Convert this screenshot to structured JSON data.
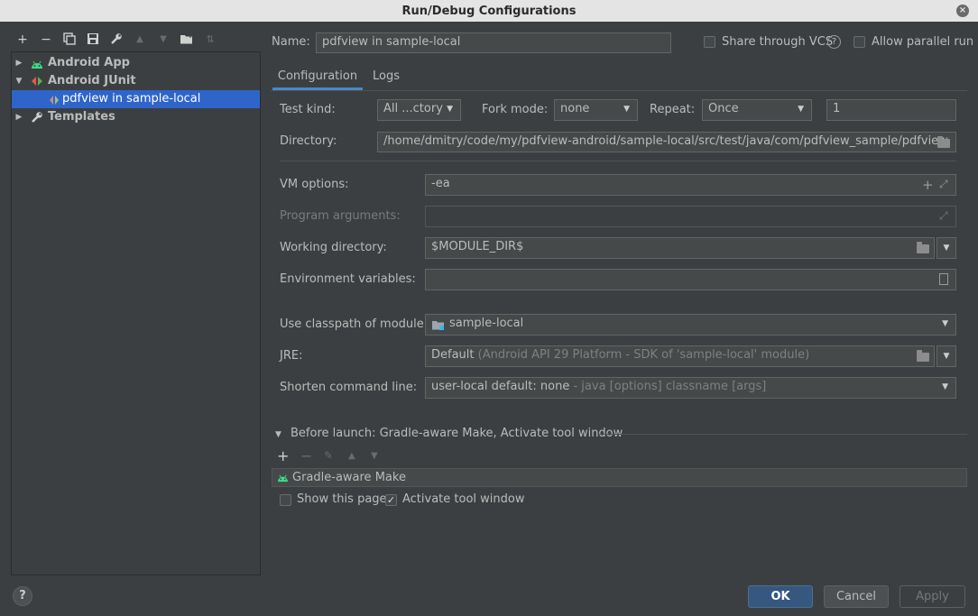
{
  "window": {
    "title": "Run/Debug Configurations",
    "close_glyph": "×"
  },
  "toolbar": {
    "icons": [
      "add-icon",
      "remove-icon",
      "copy-icon",
      "save-icon",
      "wrench-icon",
      "move-up-icon",
      "move-down-icon",
      "new-folder-icon",
      "sort-icon"
    ]
  },
  "tree": {
    "items": [
      {
        "label": "Android App",
        "icon": "android-icon",
        "expanded": false
      },
      {
        "label": "Android JUnit",
        "icon": "junit-icon",
        "expanded": true
      },
      {
        "label": "pdfview in sample-local",
        "icon": "test-class-icon",
        "selected": true
      },
      {
        "label": "Templates",
        "icon": "wrench-icon",
        "expanded": false
      }
    ]
  },
  "header": {
    "name_label": "Name:",
    "name_value": "pdfview in sample-local",
    "share_label": "Share through VCS",
    "help_glyph": "?",
    "parallel_label": "Allow parallel run"
  },
  "tabs": [
    {
      "label": "Configuration",
      "active": true
    },
    {
      "label": "Logs",
      "active": false
    }
  ],
  "config": {
    "test_kind_label": "Test kind:",
    "test_kind_value": "All ...ctory",
    "fork_mode_label": "Fork mode:",
    "fork_mode_value": "none",
    "repeat_label": "Repeat:",
    "repeat_value": "Once",
    "repeat_count": "1",
    "directory_label": "Directory:",
    "directory_value": "/home/dmitry/code/my/pdfview-android/sample-local/src/test/java/com/pdfview_sample/pdfview",
    "vm_options_label": "VM options:",
    "vm_options_value": "-ea",
    "program_args_label": "Program arguments:",
    "program_args_value": "",
    "working_dir_label": "Working directory:",
    "working_dir_value": "$MODULE_DIR$",
    "env_vars_label": "Environment variables:",
    "env_vars_value": "",
    "classpath_label": "Use classpath of module:",
    "classpath_value": "sample-local",
    "jre_label": "JRE:",
    "jre_value": "Default",
    "jre_hint": "(Android API 29 Platform - SDK of 'sample-local' module)",
    "shorten_label": "Shorten command line:",
    "shorten_value": "user-local default: none",
    "shorten_hint": "- java [options] classname [args]"
  },
  "before_launch": {
    "title": "Before launch: Gradle-aware Make, Activate tool window",
    "task": "Gradle-aware Make",
    "show_page_label": "Show this page",
    "show_page_checked": false,
    "activate_label": "Activate tool window",
    "activate_checked": true
  },
  "footer": {
    "help_glyph": "?",
    "ok": "OK",
    "cancel": "Cancel",
    "apply": "Apply"
  },
  "colors": {
    "selection": "#2f65ca",
    "accent": "#4a88c7",
    "android": "#3ddc84",
    "default_button": "#365880"
  }
}
